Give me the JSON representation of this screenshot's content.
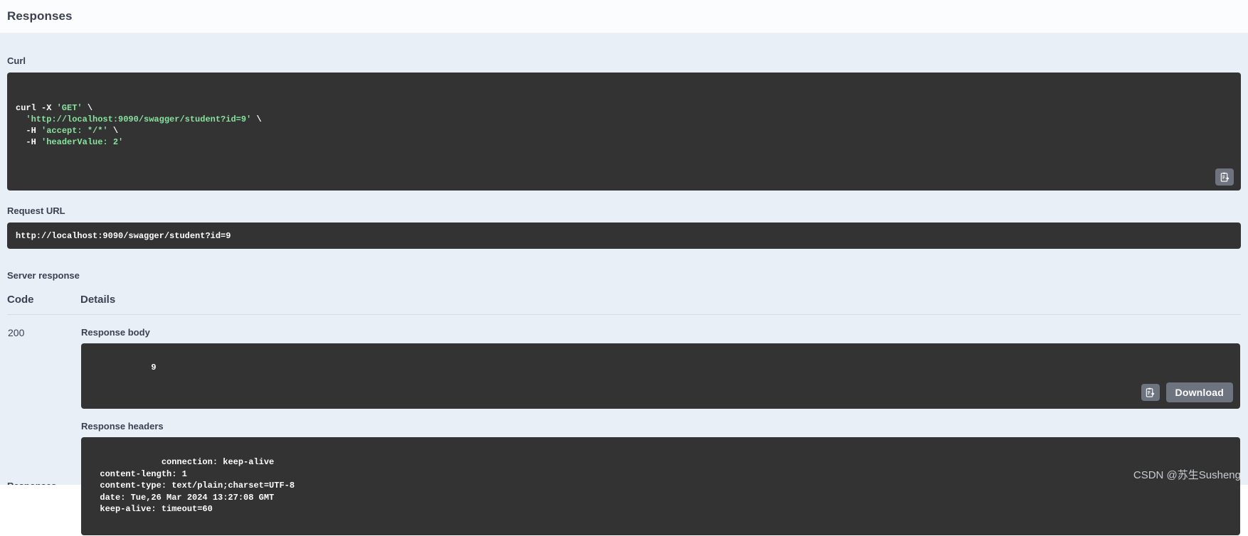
{
  "header": {
    "title": "Responses"
  },
  "curl": {
    "label": "Curl",
    "lines": [
      {
        "plain": "curl -X ",
        "string": "'GET'",
        "tail": " \\"
      },
      {
        "plain": "  ",
        "string": "'http://localhost:9090/swagger/student?id=9'",
        "tail": " \\"
      },
      {
        "plain": "  -H ",
        "string": "'accept: */*'",
        "tail": " \\"
      },
      {
        "plain": "  -H ",
        "string": "'headerValue: 2'",
        "tail": ""
      }
    ],
    "copy_icon": "copy-to-clipboard-icon"
  },
  "request_url": {
    "label": "Request URL",
    "value": "http://localhost:9090/swagger/student?id=9"
  },
  "server_response": {
    "label": "Server response",
    "columns": {
      "code": "Code",
      "details": "Details"
    },
    "rows": [
      {
        "code": "200",
        "response_body_label": "Response body",
        "response_body": "9",
        "copy_icon": "copy-to-clipboard-icon",
        "download_label": "Download",
        "response_headers_label": "Response headers",
        "response_headers": "  connection: keep-alive \n  content-length: 1 \n  content-type: text/plain;charset=UTF-8 \n  date: Tue,26 Mar 2024 13:27:08 GMT \n  keep-alive: timeout=60 "
      }
    ]
  },
  "next_section": {
    "label": "Responses"
  },
  "watermark": {
    "text": "CSDN @苏生Susheng"
  },
  "colors": {
    "page_background": "#ffffff",
    "panel_background": "#e8eff7",
    "header_background": "#fbfcfd",
    "code_background": "#333333",
    "text_primary": "#3b4151",
    "code_string": "#86e49d",
    "button_gray": "#6e7380",
    "watermark_gray": "#c7ccd3"
  }
}
